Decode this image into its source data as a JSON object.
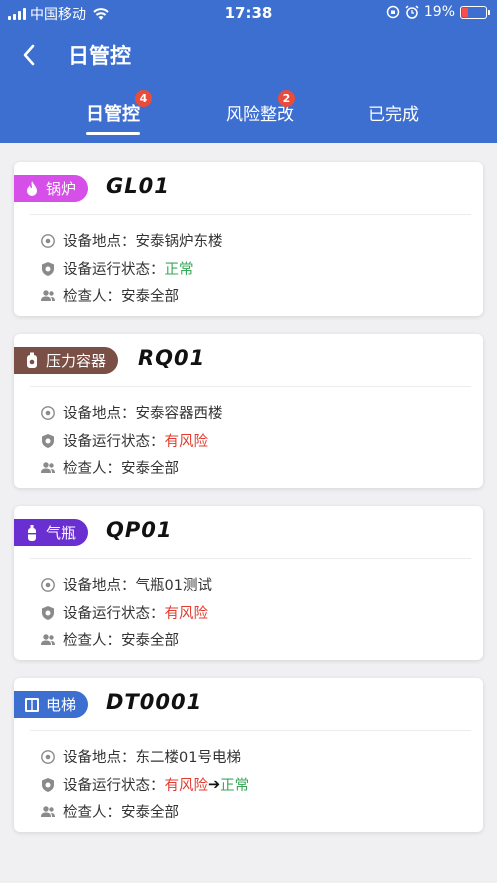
{
  "statusbar": {
    "carrier": "中国移动",
    "time": "17:38",
    "battery": "19%"
  },
  "nav": {
    "title": "日管控"
  },
  "tabs": [
    {
      "label": "日管控",
      "badge": "4",
      "active": true
    },
    {
      "label": "风险整改",
      "badge": "2",
      "active": false
    },
    {
      "label": "已完成",
      "badge": "",
      "active": false
    }
  ],
  "labels": {
    "location": "设备地点：",
    "status": "设备运行状态：",
    "inspector": "检查人："
  },
  "cards": [
    {
      "type": "锅炉",
      "type_color": "#d64fe8",
      "icon": "flame-icon",
      "code": "GL01",
      "location": "安泰锅炉东楼",
      "status": "正常",
      "status_kind": "normal",
      "inspector": "安泰全部"
    },
    {
      "type": "压力容器",
      "type_color": "#7a4f45",
      "icon": "pressure-vessel-icon",
      "code": "RQ01",
      "location": "安泰容器西楼",
      "status": "有风险",
      "status_kind": "risk",
      "inspector": "安泰全部"
    },
    {
      "type": "气瓶",
      "type_color": "#6a2fd1",
      "icon": "gas-cylinder-icon",
      "code": "QP01",
      "location": "气瓶01测试",
      "status": "有风险",
      "status_kind": "risk",
      "inspector": "安泰全部"
    },
    {
      "type": "电梯",
      "type_color": "#3d6fd1",
      "icon": "elevator-icon",
      "code": "DT0001",
      "location": "东二楼01号电梯",
      "status": "有风险",
      "status_kind": "risk",
      "status_to": "正常",
      "inspector": "安泰全部"
    }
  ]
}
